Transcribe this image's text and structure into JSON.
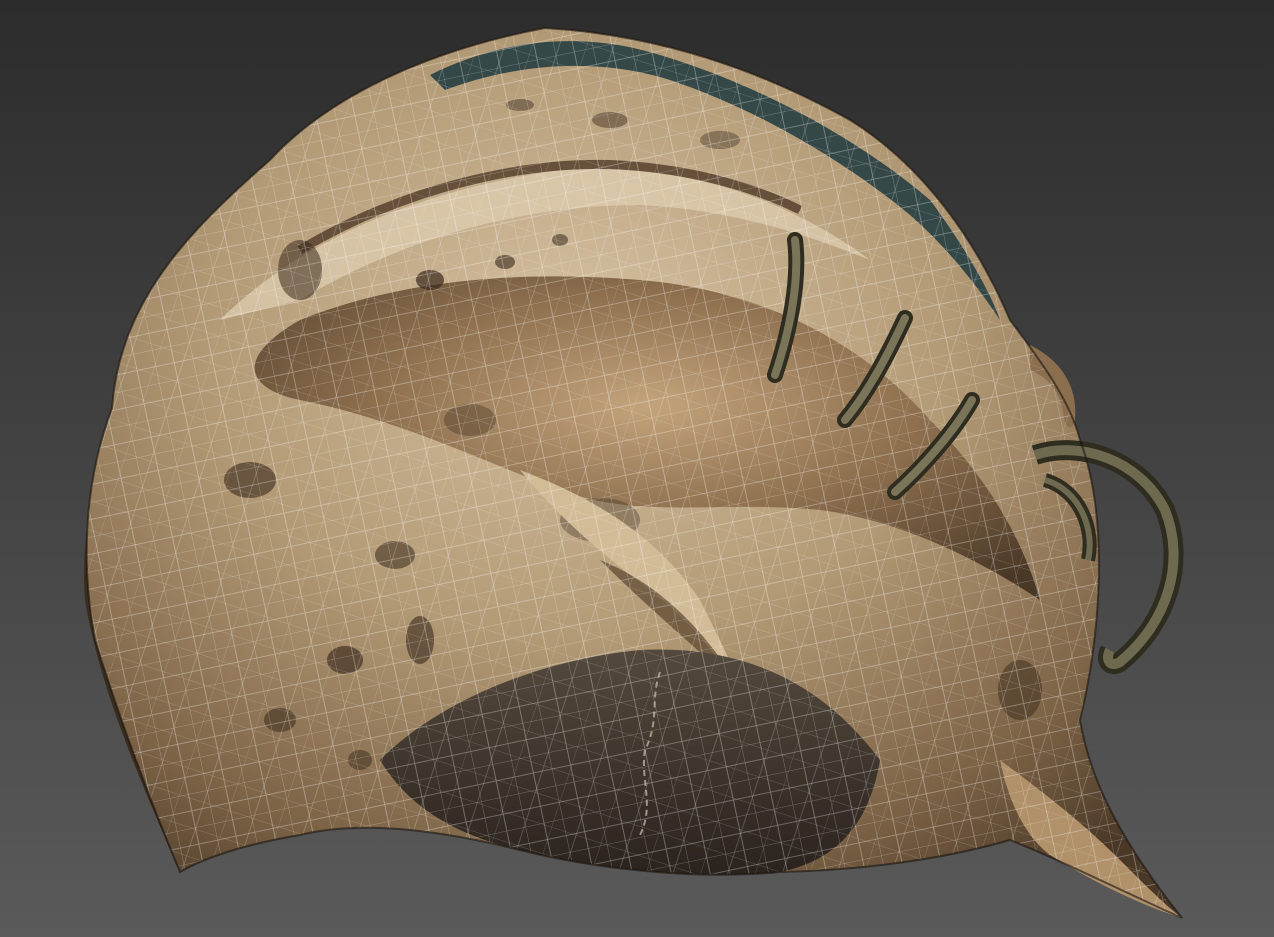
{
  "viewport": {
    "background_top": "#2c2c2c",
    "background_bottom": "#5a5a5a",
    "wireframe_color": "#ffffff"
  },
  "model": {
    "subject": "helmet-icon",
    "material_colors": {
      "leather_light": "#c9b393",
      "leather_mid": "#a08563",
      "leather_dark": "#5e4630",
      "stain": "#3a2a1c",
      "cloth": "#4a4036",
      "cloth_dark": "#2a231d",
      "teal_trim": "#1f3a40",
      "metal": "#5e5a44",
      "metal_dark": "#2f2c20"
    }
  }
}
